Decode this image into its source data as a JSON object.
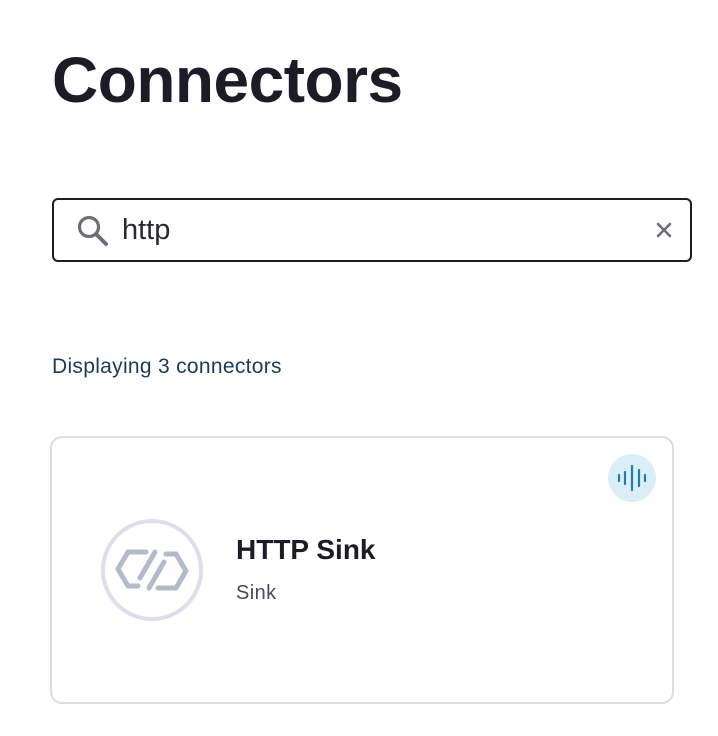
{
  "page": {
    "title": "Connectors"
  },
  "search": {
    "value": "http",
    "icons": {
      "search": "search-icon",
      "clear": "close-icon"
    }
  },
  "results": {
    "count_text": "Displaying 3 connectors"
  },
  "connectors": [
    {
      "name": "HTTP Sink",
      "type": "Sink",
      "logo_icon": "link-hexagon-icon",
      "badge_icon": "audio-wave-icon"
    }
  ],
  "colors": {
    "title": "#1c1b26",
    "count_text": "#1d3a5c",
    "badge_bg": "#d9eef5",
    "badge_icon": "#1f7fa6",
    "logo_ring": "#dcdfeb",
    "logo_glyph": "#b4bac9",
    "card_border": "#dcdce2"
  }
}
